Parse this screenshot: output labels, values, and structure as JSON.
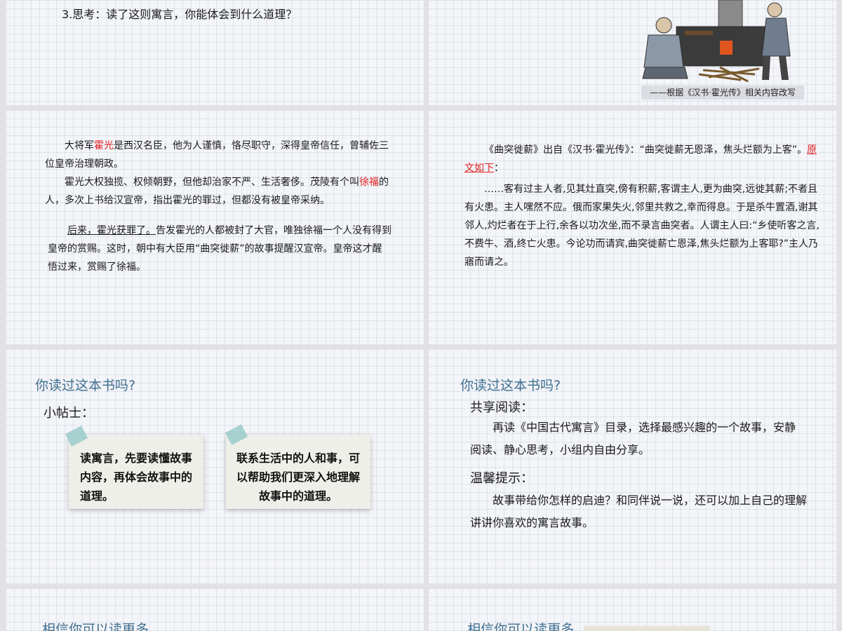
{
  "slide1": {
    "question": "3.思考：读了这则寓言，你能体会到什么道理？"
  },
  "slide2": {
    "caption": "——根据《汉书·霍光传》相关内容改写"
  },
  "slide3": {
    "p1_a": "大将军",
    "p1_b": "霍光",
    "p1_c": "是西汉名臣，他为人谨慎，恪尽职守，深得皇帝信任，曾辅佐三位皇帝治理朝政。",
    "p2_a": "霍光大权独揽、权倾朝野，但他却治家不严、生活奢侈。茂陵有个叫",
    "p2_b": "徐福",
    "p2_c": "的人，多次上书给汉宣帝，指出霍光的罪过，但都没有被皇帝采纳。",
    "p3_a": "后来，霍光获罪了。",
    "p3_b": "告发霍光的人都被封了大官，唯独徐福一个人没有得到皇帝的赏赐。这时，朝中有大臣用“曲突徙薪”的故事提醒汉宣帝。皇帝这才醒悟过来，赏赐了徐福。"
  },
  "slide4": {
    "p1_a": "《曲突徙薪》出自《汉书·霍光传》：“曲突徙薪无恩泽，焦头烂额为上客”。",
    "p1_b": "原文如下",
    "p1_c": "：",
    "p2": "……客有过主人者,见其灶直突,傍有积薪,客谓主人,更为曲突,远徙其薪;不者且有火患。主人嘿然不应。俄而家果失火,邻里共救之,幸而得息。于是杀牛置酒,谢其邻人,灼烂者在于上行,余各以功次坐,而不录言曲突者。人谓主人曰:“乡使听客之言,不费牛、酒,终亡火患。今论功而请宾,曲突徙薪亡恩泽,焦头烂额为上客耶?”主人乃寤而请之。"
  },
  "slide5": {
    "heading": "你读过这本书吗?",
    "subheading": "小帖士：",
    "note1": "读寓言，先要读懂故事内容，再体会故事中的道理。",
    "note2": "联系生活中的人和事，可以帮助我们更深入地理解故事中的道理。"
  },
  "slide6": {
    "heading": "你读过这本书吗?",
    "share_title": "共享阅读：",
    "share_text": "再读《中国古代寓言》目录，选择最感兴趣的一个故事，安静阅读、静心思考，小组内自由分享。",
    "tip_title": "温馨提示：",
    "tip_text": "故事带给你怎样的启迪？和同伴说一说，还可以加上自己的理解讲讲你喜欢的寓言故事。"
  },
  "slide7": {
    "heading": "相信你可以读更多"
  },
  "slide8": {
    "heading": "相信你可以读更多"
  },
  "colors": {
    "heading_blue": "#3f6f8f",
    "highlight_red": "#e02020"
  }
}
